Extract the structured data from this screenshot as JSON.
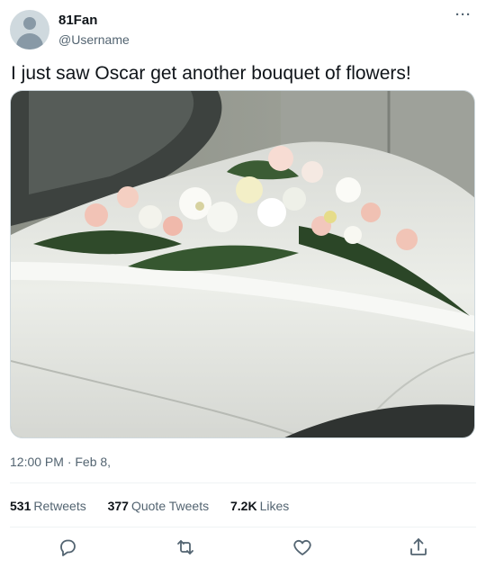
{
  "tweet": {
    "display_name": "81Fan",
    "handle": "@Username",
    "more_label": "···",
    "text": "I just saw Oscar get another bouquet of flowers!",
    "timestamp": "12:00 PM · Feb 8,",
    "media": {
      "alt_description": ""
    }
  },
  "stats": {
    "retweets": {
      "count": "531",
      "label": "Retweets"
    },
    "quote_tweets": {
      "count": "377",
      "label": "Quote Tweets"
    },
    "likes": {
      "count": "7.2K",
      "label": "Likes"
    }
  },
  "actions": [
    {
      "icon": "reply-icon"
    },
    {
      "icon": "retweet-icon"
    },
    {
      "icon": "like-icon"
    },
    {
      "icon": "share-icon"
    }
  ],
  "colors": {
    "text_primary": "#0f1419",
    "text_secondary": "#536471",
    "divider": "#eff3f4",
    "avatar_bg": "#cfd9de"
  }
}
